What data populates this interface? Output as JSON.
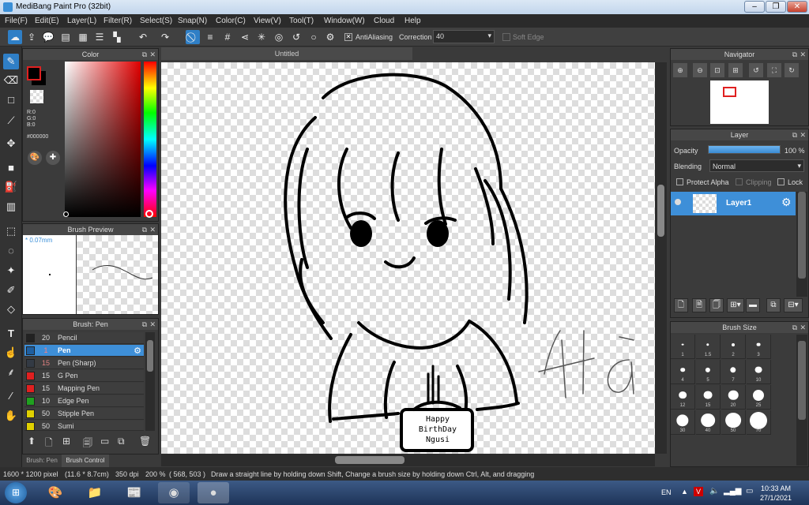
{
  "window": {
    "title": "MediBang Paint Pro (32bit)",
    "min": "–",
    "max": "❐",
    "close": "✕"
  },
  "menu": [
    "File(F)",
    "Edit(E)",
    "Layer(L)",
    "Filter(R)",
    "Select(S)",
    "Snap(N)",
    "Color(C)",
    "View(V)",
    "Tool(T)",
    "Window(W)",
    "Cloud",
    "Help"
  ],
  "toolbar": {
    "antialiasing_label": "AntiAliasing",
    "correction_label": "Correction",
    "correction_value": "40",
    "soft_edge_label": "Soft Edge"
  },
  "color_panel": {
    "title": "Color",
    "r": "R:0",
    "g": "G:0",
    "b": "B:0",
    "hex": "#000000",
    "foreground": "#000000",
    "background": "#000000"
  },
  "brush_preview": {
    "title": "Brush Preview",
    "size": "* 0.07mm"
  },
  "brush_list": {
    "title": "Brush: Pen",
    "items": [
      {
        "size": "20",
        "name": "Pencil",
        "color": "#222222"
      },
      {
        "size": "1",
        "name": "Pen",
        "color": "#1f5f9f"
      },
      {
        "size": "15",
        "name": "Pen (Sharp)",
        "color": "#333a44"
      },
      {
        "size": "15",
        "name": "G Pen",
        "color": "#e02020"
      },
      {
        "size": "15",
        "name": "Mapping Pen",
        "color": "#e02020"
      },
      {
        "size": "10",
        "name": "Edge Pen",
        "color": "#20a020"
      },
      {
        "size": "50",
        "name": "Stipple Pen",
        "color": "#e0d000"
      },
      {
        "size": "50",
        "name": "Sumi",
        "color": "#e0d000"
      }
    ]
  },
  "left_tabs": {
    "brush_tab": "Brush: Pen",
    "brush_control_tab": "Brush Control"
  },
  "document": {
    "tab": "Untitled"
  },
  "canvas": {
    "cake_text": "Happy BirthDay Ngusi",
    "side_text": "Hà"
  },
  "navigator": {
    "title": "Navigator"
  },
  "layer_panel": {
    "title": "Layer",
    "opacity_label": "Opacity",
    "opacity_value": "100 %",
    "opacity_fraction": 1.0,
    "blending_label": "Blending",
    "blending_value": "Normal",
    "protect_alpha": "Protect Alpha",
    "clipping": "Clipping",
    "lock": "Lock",
    "layers": [
      {
        "name": "Layer1"
      }
    ]
  },
  "brush_size": {
    "title": "Brush Size",
    "sizes": [
      "1",
      "1.5",
      "2",
      "3",
      "4",
      "5",
      "7",
      "10",
      "12",
      "15",
      "20",
      "25",
      "30",
      "40",
      "50",
      "70"
    ]
  },
  "status": {
    "dimensions": "1600 * 1200 pixel",
    "physical": "(11.6 * 8.7cm)",
    "dpi": "350 dpi",
    "zoom": "200 %",
    "cursor": "( 568, 503 )",
    "hint": "Draw a straight line by holding down Shift, Change a brush size by holding down Ctrl, Alt, and dragging"
  },
  "taskbar": {
    "lang": "EN",
    "time": "10:33 AM",
    "date": "27/1/2021"
  }
}
